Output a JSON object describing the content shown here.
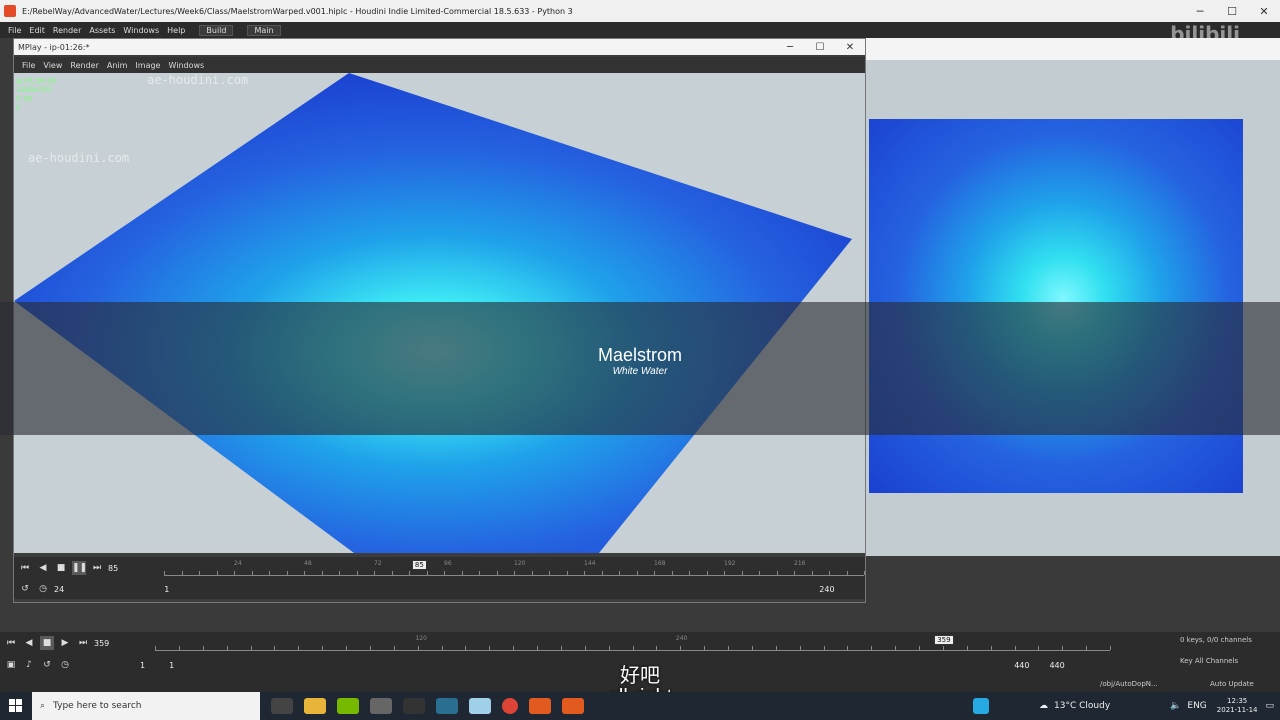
{
  "window": {
    "title": "E:/RebelWay/AdvancedWater/Lectures/Week6/Class/MaelstromWarped.v001.hiplc - Houdini Indie Limited-Commercial 18.5.633 - Python 3",
    "controls": [
      "─",
      "☐",
      "✕"
    ]
  },
  "menubar": {
    "items": [
      "File",
      "Edit",
      "Render",
      "Assets",
      "Windows",
      "Help"
    ],
    "desk_build": "Build",
    "desk_main": "Main"
  },
  "watermark_brand": "bilibili",
  "mplay": {
    "title": "MPlay - ip-01:26:*",
    "menu": [
      "File",
      "View",
      "Render",
      "Anim",
      "Image",
      "Windows"
    ],
    "hud": [
      "ip-01:26:26",
      "1280x720",
      "fr 85",
      "C"
    ],
    "watermarks": [
      "ae-houdini.com",
      "ae-houdini.com"
    ],
    "frame": "85",
    "fps": "24",
    "range_start": "1",
    "range_end": "240",
    "ruler_labels": [
      "24",
      "48",
      "72",
      "96",
      "120",
      "144",
      "168",
      "192",
      "216"
    ],
    "current_marker": "85"
  },
  "overlay": {
    "title": "Maelstrom",
    "subtitle": "White Water"
  },
  "timeline": {
    "frame": "359",
    "current_marker": "359",
    "ruler_labels": [
      "120",
      "240"
    ],
    "start": "1",
    "start2": "1",
    "end": "440",
    "end2": "440",
    "keys_info": "0 keys, 0/0 channels",
    "key_all": "Key All Channels",
    "obj_path": "/obj/AutoDopN...",
    "auto_update": "Auto Update"
  },
  "subtitle": {
    "cn": "好吧",
    "en": "all right"
  },
  "taskbar": {
    "search_placeholder": "Type here to search",
    "weather": "13°C  Cloudy",
    "lang": "ENG",
    "time": "12:35",
    "date": "2021-11-14"
  },
  "colors": {
    "water_deep": "#1a40d0",
    "water_mid": "#2563e0",
    "water_foam": "#7ff8ff",
    "viewport_bg": "#c7d0d4"
  }
}
